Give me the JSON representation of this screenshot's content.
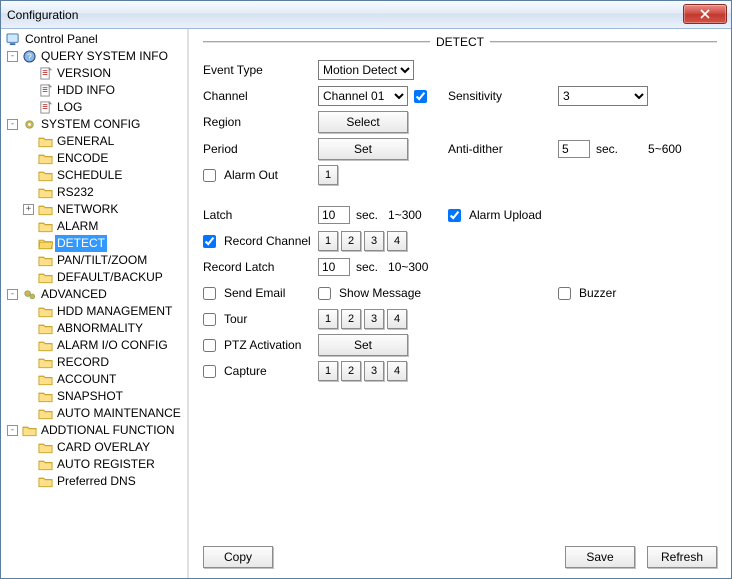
{
  "window": {
    "title": "Configuration"
  },
  "tree": {
    "root": "Control Panel",
    "groups": [
      {
        "label": "QUERY SYSTEM INFO",
        "expanded": true,
        "icon": "qmark",
        "items": [
          {
            "label": "VERSION",
            "icon": "doc"
          },
          {
            "label": "HDD INFO",
            "icon": "doc"
          },
          {
            "label": "LOG",
            "icon": "doc"
          }
        ]
      },
      {
        "label": "SYSTEM CONFIG",
        "expanded": true,
        "icon": "gear",
        "items": [
          {
            "label": "GENERAL",
            "icon": "folder"
          },
          {
            "label": "ENCODE",
            "icon": "folder"
          },
          {
            "label": "SCHEDULE",
            "icon": "folder"
          },
          {
            "label": "RS232",
            "icon": "folder"
          },
          {
            "label": "NETWORK",
            "icon": "folder",
            "expander": "+"
          },
          {
            "label": "ALARM",
            "icon": "folder"
          },
          {
            "label": "DETECT",
            "icon": "folder-open",
            "selected": true
          },
          {
            "label": "PAN/TILT/ZOOM",
            "icon": "folder"
          },
          {
            "label": "DEFAULT/BACKUP",
            "icon": "folder"
          }
        ]
      },
      {
        "label": "ADVANCED",
        "expanded": true,
        "icon": "gears",
        "items": [
          {
            "label": "HDD MANAGEMENT",
            "icon": "folder"
          },
          {
            "label": "ABNORMALITY",
            "icon": "folder"
          },
          {
            "label": "ALARM I/O CONFIG",
            "icon": "folder"
          },
          {
            "label": "RECORD",
            "icon": "folder"
          },
          {
            "label": "ACCOUNT",
            "icon": "folder"
          },
          {
            "label": "SNAPSHOT",
            "icon": "folder"
          },
          {
            "label": "AUTO MAINTENANCE",
            "icon": "folder"
          }
        ]
      },
      {
        "label": "ADDTIONAL FUNCTION",
        "expanded": true,
        "icon": "folder",
        "items": [
          {
            "label": "CARD OVERLAY",
            "icon": "folder"
          },
          {
            "label": "AUTO REGISTER",
            "icon": "folder"
          },
          {
            "label": "Preferred DNS",
            "icon": "folder"
          }
        ]
      }
    ]
  },
  "panel": {
    "heading": "DETECT",
    "labels": {
      "event_type": "Event Type",
      "channel": "Channel",
      "region": "Region",
      "sensitivity": "Sensitivity",
      "period": "Period",
      "anti_dither": "Anti-dither",
      "alarm_out": "Alarm Out",
      "latch": "Latch",
      "alarm_upload": "Alarm Upload",
      "record_channel": "Record Channel",
      "record_latch": "Record Latch",
      "send_email": "Send Email",
      "show_message": "Show Message",
      "buzzer": "Buzzer",
      "tour": "Tour",
      "ptz_activation": "PTZ Activation",
      "capture": "Capture",
      "sec": "sec.",
      "range_latch": "1~300",
      "range_reclatch": "10~300",
      "range_dither": "5~600"
    },
    "buttons": {
      "select": "Select",
      "set": "Set",
      "copy": "Copy",
      "save": "Save",
      "refresh": "Refresh"
    },
    "values": {
      "event_type": "Motion Detect",
      "channel": "Channel 01",
      "channel_enabled": true,
      "sensitivity": "3",
      "anti_dither": "5",
      "alarm_out_enabled": false,
      "alarm_out": "1",
      "latch": "10",
      "alarm_upload_enabled": true,
      "record_channel_enabled": true,
      "record_latch": "10",
      "send_email": false,
      "show_message": false,
      "buzzer": false,
      "tour": false,
      "ptz_activation": false,
      "capture": false
    },
    "num_buttons": [
      "1",
      "2",
      "3",
      "4"
    ]
  }
}
